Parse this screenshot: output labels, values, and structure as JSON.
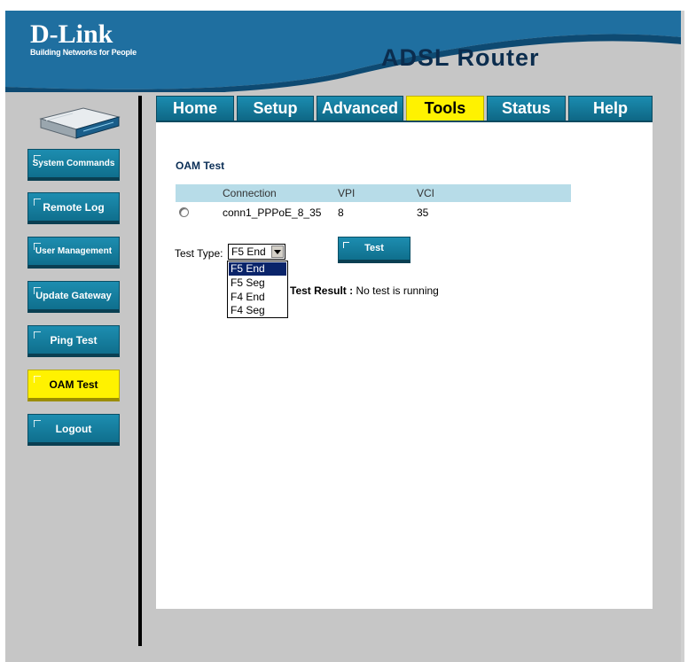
{
  "brand": {
    "name": "D-Link",
    "tagline": "Building Networks for People",
    "product": "ADSL Router"
  },
  "tabs": [
    {
      "label": "Home",
      "active": false
    },
    {
      "label": "Setup",
      "active": false
    },
    {
      "label": "Advanced",
      "active": false
    },
    {
      "label": "Tools",
      "active": true
    },
    {
      "label": "Status",
      "active": false
    },
    {
      "label": "Help",
      "active": false
    }
  ],
  "sidebar": {
    "items": [
      {
        "label": "System Commands",
        "active": false
      },
      {
        "label": "Remote Log",
        "active": false
      },
      {
        "label": "User Management",
        "active": false
      },
      {
        "label": "Update Gateway",
        "active": false
      },
      {
        "label": "Ping Test",
        "active": false
      },
      {
        "label": "OAM Test",
        "active": true
      },
      {
        "label": "Logout",
        "active": false
      }
    ]
  },
  "main": {
    "title": "OAM Test",
    "table": {
      "headers": [
        "Connection",
        "VPI",
        "VCI"
      ],
      "rows": [
        {
          "connection": "conn1_PPPoE_8_35",
          "vpi": "8",
          "vci": "35"
        }
      ]
    },
    "test_type_label": "Test Type:",
    "test_type_value": "F5 End",
    "test_type_options": [
      "F5 End",
      "F5 Seg",
      "F4 End",
      "F4 Seg"
    ],
    "test_button": "Test",
    "result_label": "Test Result :",
    "result_text": "No test is running"
  },
  "colors": {
    "header_blue": "#1f6fa0",
    "frame_gray": "#c6c6c6",
    "button_teal": "#1284a8",
    "active_yellow": "#fff200",
    "table_header": "#b7dce8",
    "title_navy": "#0b2d4e"
  }
}
